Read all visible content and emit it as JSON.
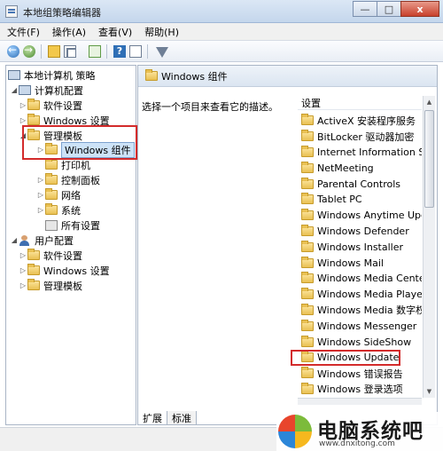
{
  "window": {
    "title": "本地组策略编辑器",
    "buttons": {
      "minimize": "—",
      "maximize": "□",
      "close": "x"
    }
  },
  "menubar": {
    "items": [
      "文件(F)",
      "操作(A)",
      "查看(V)",
      "帮助(H)"
    ]
  },
  "toolbar": {
    "help_glyph": "?"
  },
  "tree": {
    "root": "本地计算机 策略",
    "computer_config": "计算机配置",
    "software_settings": "软件设置",
    "windows_settings": "Windows 设置",
    "admin_templates": "管理模板",
    "windows_components": "Windows 组件",
    "printers": "打印机",
    "control_panel": "控制面板",
    "network": "网络",
    "system": "系统",
    "all_settings": "所有设置",
    "user_config": "用户配置",
    "user_software_settings": "软件设置",
    "user_windows_settings": "Windows 设置",
    "user_admin_templates": "管理模板"
  },
  "detail": {
    "header": "Windows 组件",
    "description": "选择一个项目来查看它的描述。",
    "column_header": "设置",
    "items": [
      "ActiveX 安装程序服务",
      "BitLocker 驱动器加密",
      "Internet Information Serv",
      "NetMeeting",
      "Parental Controls",
      "Tablet PC",
      "Windows Anytime Upgrad",
      "Windows Defender",
      "Windows Installer",
      "Windows Mail",
      "Windows Media Center",
      "Windows Media Player",
      "Windows Media 数字权限",
      "Windows Messenger",
      "Windows SideShow",
      "Windows Update",
      "Windows 错误报告",
      "Windows 登录选项"
    ]
  },
  "tabs": {
    "extended": "扩展",
    "standard": "标准"
  },
  "watermark": {
    "brand": "电脑系统吧",
    "url": "www.dnxitong.com"
  }
}
